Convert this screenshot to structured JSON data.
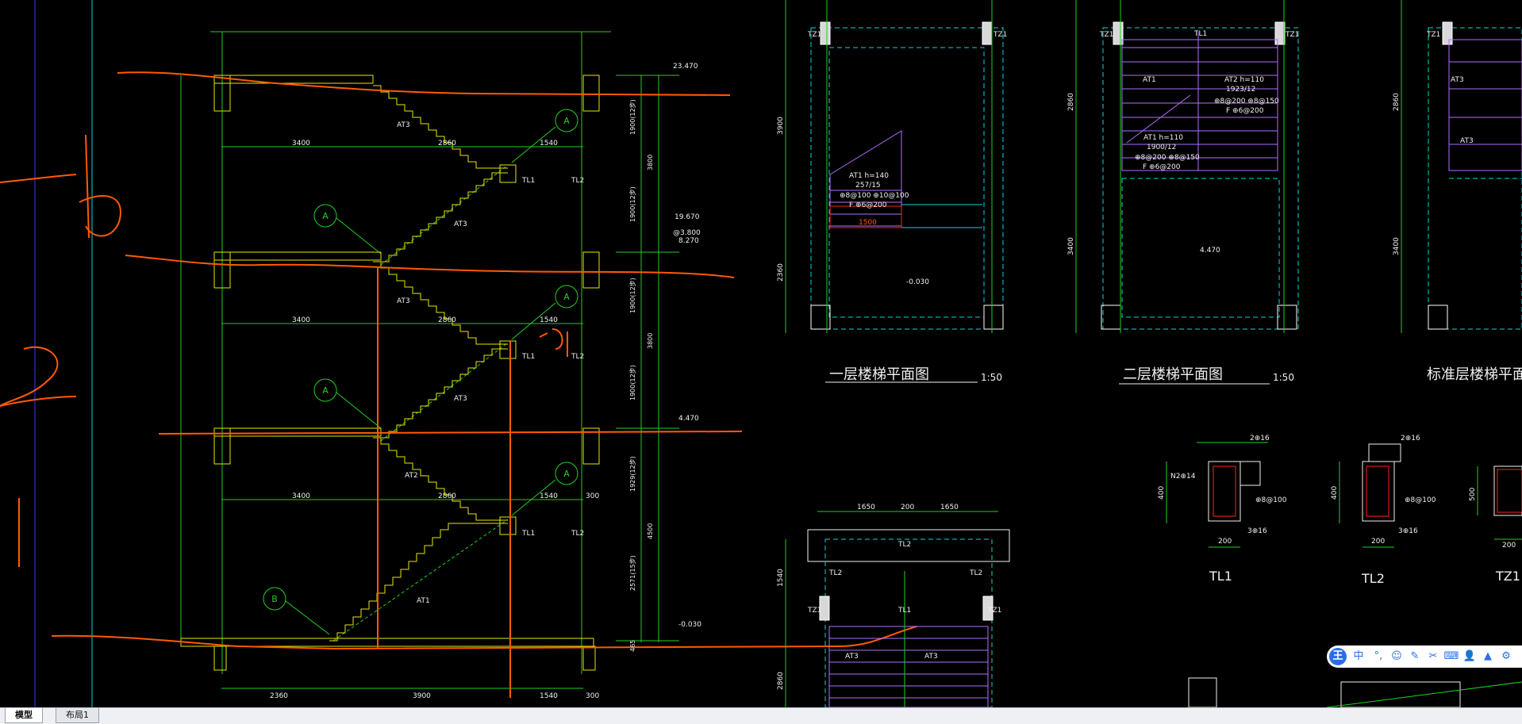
{
  "tabs": [
    {
      "label": "模型",
      "active": true
    },
    {
      "label": "布局1",
      "active": false
    }
  ],
  "section": {
    "elevations": [
      "23.470",
      "19.670",
      "@3.800",
      "8.270",
      "4.470",
      "-0.030"
    ],
    "height_dims": [
      "1900(12步)",
      "3800",
      "1900(12步)",
      "1900(12步)",
      "3800",
      "1900(12步)",
      "1929(12步)",
      "4500",
      "2571(15步)",
      "465"
    ],
    "bottom_dims": [
      "2360",
      "3900",
      "1540",
      "300"
    ],
    "row_dims": [
      "3400",
      "2860",
      "1540",
      "300"
    ],
    "flight_labels": [
      "AT3",
      "AT3",
      "AT3",
      "AT3",
      "AT2",
      "AT1"
    ],
    "beam_labels": [
      "TL1",
      "TL2"
    ],
    "axis_label": "A",
    "axis_label_b": "B"
  },
  "plans": {
    "plan1": {
      "title": "一层楼梯平面图",
      "scale": "1:50",
      "col": "TZ1",
      "note1": "AT1 h=140",
      "note2": "257/15",
      "note3": "⊕8@100 ⊕10@100",
      "note4": "F ⊕6@200",
      "elev": "-0.030",
      "dim_a": "3900",
      "dim_b": "2360",
      "dim_c": "1500"
    },
    "plan2": {
      "title": "二层楼梯平面图",
      "scale": "1:50",
      "col": "TZ1",
      "beam": "TL1",
      "at1": "AT1",
      "at2": "AT2 h=110",
      "at2b": "1923/12",
      "at2c": "⊕8@200 ⊕8@150",
      "at2d": "F ⊕6@200",
      "at1b": "AT1 h=110",
      "at1c": "1900/12",
      "at1d": "⊕8@200 ⊕8@150",
      "at1e": "F ⊕6@200",
      "elev": "4.470",
      "dim_a": "2860",
      "dim_b": "3400"
    },
    "plan3": {
      "title": "标准层楼梯平面图",
      "col": "TZ1",
      "at": "AT3",
      "dim_a": "2860",
      "dim_b": "3400"
    },
    "plan4": {
      "dims": [
        "1650",
        "200",
        "1650"
      ],
      "tl1": "TL1",
      "tl2": "TL2",
      "tz": "TZ1",
      "at": "AT3",
      "dim_v": "1540",
      "dim_v2": "2860"
    }
  },
  "details": {
    "tl1": {
      "label": "TL1",
      "top": "2⊕16",
      "side": "N2⊕14",
      "stirrup": "⊕8@100",
      "bottom": "3⊕16",
      "w": "200",
      "h": "400"
    },
    "tl2": {
      "label": "TL2",
      "top": "2⊕16",
      "stirrup": "⊕8@100",
      "bottom": "3⊕16",
      "w": "200",
      "h": "400"
    },
    "tz1": {
      "label": "TZ1",
      "w": "200",
      "h": "500"
    }
  },
  "handwriting": {
    "note": "1/2"
  },
  "ime_toolbar": {
    "logo": "王",
    "lang": "中"
  },
  "colors": {
    "green": "#1fd11f",
    "yellow": "#e6e600",
    "cyan": "#00d7d7",
    "purple": "#b070ff",
    "orange": "#ff5a00",
    "red": "#ff2020",
    "white": "#f0f0f0"
  }
}
